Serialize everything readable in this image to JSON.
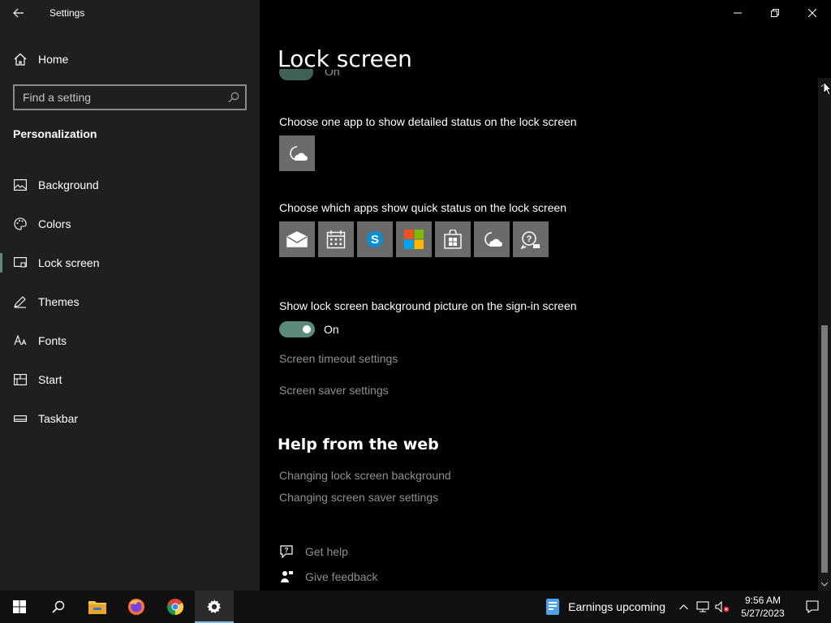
{
  "window": {
    "title": "Settings"
  },
  "sidebar": {
    "home_label": "Home",
    "search_placeholder": "Find a setting",
    "section_title": "Personalization",
    "items": [
      {
        "label": "Background",
        "icon": "image-icon"
      },
      {
        "label": "Colors",
        "icon": "palette-icon"
      },
      {
        "label": "Lock screen",
        "icon": "lock-screen-icon",
        "active": true
      },
      {
        "label": "Themes",
        "icon": "brush-icon"
      },
      {
        "label": "Fonts",
        "icon": "font-icon"
      },
      {
        "label": "Start",
        "icon": "start-icon"
      },
      {
        "label": "Taskbar",
        "icon": "taskbar-icon"
      }
    ]
  },
  "main": {
    "title": "Lock screen",
    "detailed_status_label": "Choose one app to show detailed status on the lock screen",
    "detailed_status_app": "weather-icon",
    "quick_status_label": "Choose which apps show quick status on the lock screen",
    "quick_status_apps": [
      "mail-icon",
      "calendar-icon",
      "skype-icon",
      "microsoft-store-icon",
      "store-bag-icon",
      "weather-icon",
      "feedback-icon"
    ],
    "signin_bg_label": "Show lock screen background picture on the sign-in screen",
    "signin_bg_state": "On",
    "links": {
      "timeout": "Screen timeout settings",
      "saver": "Screen saver settings"
    },
    "help": {
      "title": "Help from the web",
      "link1": "Changing lock screen background",
      "link2": "Changing screen saver settings",
      "get_help": "Get help",
      "give_feedback": "Give feedback"
    }
  },
  "taskbar": {
    "pinned": [
      "windows-start-icon",
      "search-icon",
      "file-explorer-icon",
      "firefox-icon",
      "chrome-icon",
      "settings-icon"
    ],
    "weather_text": "Earnings upcoming",
    "time": "9:56 AM",
    "date": "5/27/2023"
  },
  "colors": {
    "accent": "#5a8a7c",
    "sidebar_bg": "#1f1f1f",
    "main_bg": "#000000",
    "link": "#8f8f8f"
  }
}
